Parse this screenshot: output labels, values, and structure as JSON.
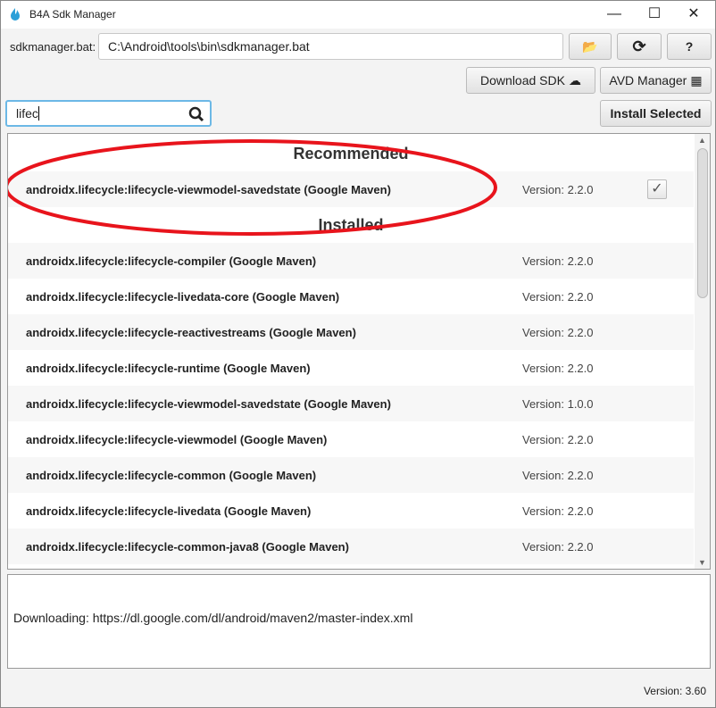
{
  "window": {
    "title": "B4A Sdk Manager",
    "minimize": "—",
    "maximize": "☐",
    "close": "✕"
  },
  "toolbar": {
    "sdk_label": "sdkmanager.bat:",
    "sdk_path": "C:\\Android\\tools\\bin\\sdkmanager.bat",
    "download_sdk": "Download SDK",
    "avd_manager": "AVD Manager",
    "install_selected": "Install Selected",
    "help": "?"
  },
  "search": {
    "value": "lifec"
  },
  "list": {
    "recommended_header": "Recommended",
    "installed_header": "Installed",
    "recommended": [
      {
        "name": "androidx.lifecycle:lifecycle-viewmodel-savedstate (Google Maven)",
        "version": "Version: 2.2.0",
        "checked": true
      }
    ],
    "installed": [
      {
        "name": "androidx.lifecycle:lifecycle-compiler (Google Maven)",
        "version": "Version: 2.2.0"
      },
      {
        "name": "androidx.lifecycle:lifecycle-livedata-core (Google Maven)",
        "version": "Version: 2.2.0"
      },
      {
        "name": "androidx.lifecycle:lifecycle-reactivestreams (Google Maven)",
        "version": "Version: 2.2.0"
      },
      {
        "name": "androidx.lifecycle:lifecycle-runtime (Google Maven)",
        "version": "Version: 2.2.0"
      },
      {
        "name": "androidx.lifecycle:lifecycle-viewmodel-savedstate (Google Maven)",
        "version": "Version: 1.0.0"
      },
      {
        "name": "androidx.lifecycle:lifecycle-viewmodel (Google Maven)",
        "version": "Version: 2.2.0"
      },
      {
        "name": "androidx.lifecycle:lifecycle-common (Google Maven)",
        "version": "Version: 2.2.0"
      },
      {
        "name": "androidx.lifecycle:lifecycle-livedata (Google Maven)",
        "version": "Version: 2.2.0"
      },
      {
        "name": "androidx.lifecycle:lifecycle-common-java8 (Google Maven)",
        "version": "Version: 2.2.0"
      }
    ]
  },
  "log": {
    "text": "Downloading: https://dl.google.com/dl/android/maven2/master-index.xml"
  },
  "footer": {
    "version": "Version: 3.60"
  },
  "colors": {
    "annotation": "#e8141c",
    "focus": "#6cb8e6"
  }
}
